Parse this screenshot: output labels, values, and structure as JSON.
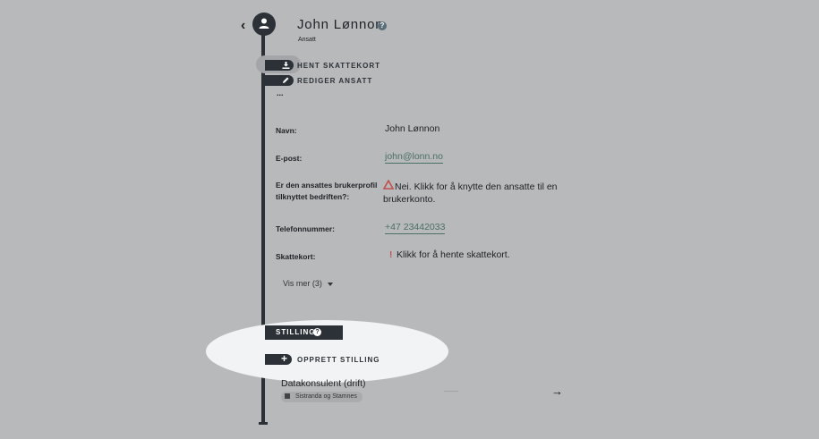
{
  "header": {
    "back_glyph": "‹",
    "name": "John Lønnon",
    "help_glyph": "?",
    "role": "Ansatt"
  },
  "actions": {
    "fetch_tax_card": "HENT SKATTEKORT",
    "edit_employee": "REDIGER ANSATT",
    "more": "..."
  },
  "details": {
    "name_label": "Navn:",
    "name_value": "John Lønnon",
    "email_label": "E-post:",
    "email_value": "john@lonn.no",
    "profile_label_line1": "Er den ansattes brukerprofil",
    "profile_label_line2": "tilknyttet bedriften?:",
    "profile_value_line1": "Nei. Klikk for å knytte den ansatte til en",
    "profile_value_line2": "brukerkonto.",
    "phone_label": "Telefonnummer:",
    "phone_value": "+47 23442033",
    "taxcard_label": "Skattekort:",
    "taxcard_value": "Klikk for å hente skattekort.",
    "show_more": "Vis mer (3)"
  },
  "position": {
    "section_title": "STILLING",
    "help_glyph": "?",
    "create_label": "OPPRETT STILLING",
    "create_glyph": "+",
    "job_title": "Datakonsulent (drift)",
    "job_location": "Sistranda og Stamnes",
    "open_glyph": "→"
  },
  "colors": {
    "background": "#b8b9bb",
    "timeline": "#2b3136",
    "link": "#4c6f66",
    "warning": "#c0504d",
    "highlight": "#f2f3f4"
  },
  "icons": [
    "chevron-left-icon",
    "user-icon",
    "help-icon",
    "download-icon",
    "pencil-icon",
    "warning-icon",
    "exclamation-icon",
    "caret-down-icon",
    "plus-icon",
    "building-icon",
    "arrow-right-icon"
  ]
}
